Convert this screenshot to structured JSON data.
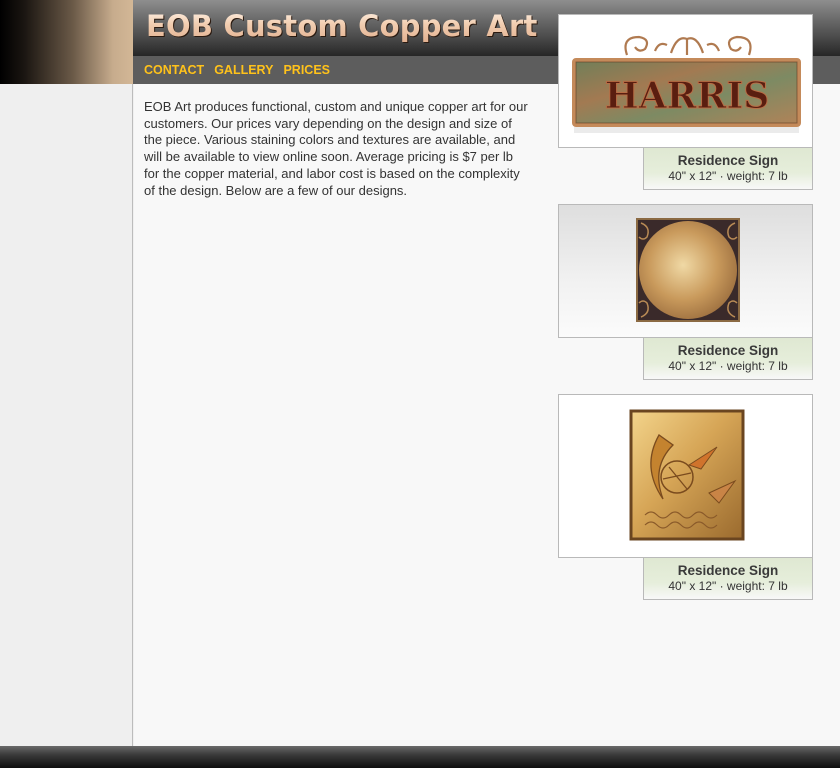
{
  "header": {
    "title": "EOB Custom Copper Art"
  },
  "nav": {
    "items": [
      {
        "label": "CONTACT"
      },
      {
        "label": "GALLERY"
      },
      {
        "label": "PRICES"
      }
    ]
  },
  "main": {
    "intro": "EOB Art produces functional, custom and unique copper art for our customers.  Our prices vary depending on the design and size of the piece. Various staining colors and textures are available, and will be available to view online soon. Average pricing is $7 per lb for the copper material, and labor cost is based on the complexity of the design. Below are a few of our designs."
  },
  "gallery": {
    "items": [
      {
        "image_text": "HARRIS",
        "title": "Residence Sign",
        "detail": "40\" x 12\" · weight: 7 lb"
      },
      {
        "image_text": "",
        "title": "Residence Sign",
        "detail": "40\" x 12\" · weight: 7 lb"
      },
      {
        "image_text": "",
        "title": "Residence Sign",
        "detail": "40\" x 12\" · weight: 7 lb"
      }
    ]
  },
  "colors": {
    "nav_link": "#ffc21a",
    "title_copper": "#f1cdb0",
    "caption_bg": "#e1ead5"
  }
}
